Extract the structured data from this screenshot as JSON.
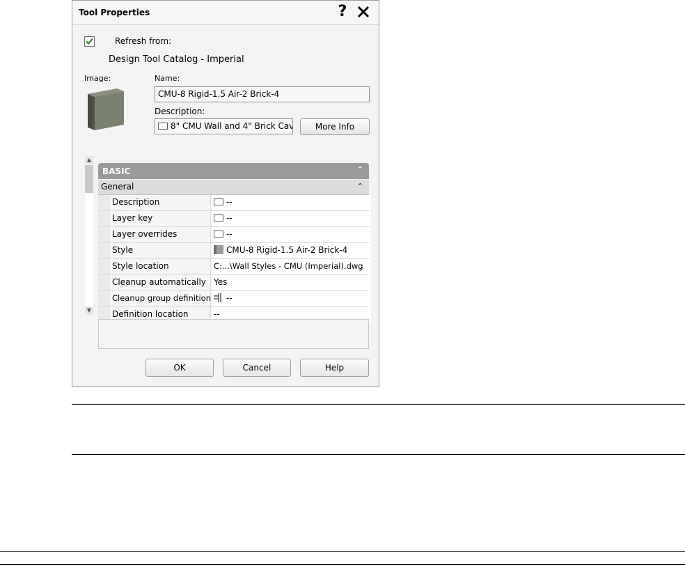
{
  "dialog": {
    "title": "Tool Properties",
    "refresh_label": "Refresh from:",
    "refresh_checked": true,
    "catalog_name": "Design Tool Catalog - Imperial",
    "image_label": "Image:",
    "name_label": "Name:",
    "name_value": "CMU-8 Rigid-1.5 Air-2 Brick-4",
    "description_label": "Description:",
    "description_value": "8\" CMU Wall and 4\" Brick Cav",
    "more_info_label": "More Info"
  },
  "properties": {
    "category": "BASIC",
    "group": "General",
    "rows": [
      {
        "key": "Description",
        "value": "--",
        "icon": "message-icon"
      },
      {
        "key": "Layer key",
        "value": "--",
        "icon": "message-icon"
      },
      {
        "key": "Layer overrides",
        "value": "--",
        "icon": "message-icon"
      },
      {
        "key": "Style",
        "value": "CMU-8 Rigid-1.5 Air-2 Brick-4",
        "icon": "wall-style-icon"
      },
      {
        "key": "Style location",
        "value": "C:...\\Wall Styles - CMU (Imperial).dwg",
        "icon": ""
      },
      {
        "key": "Cleanup automatically",
        "value": "Yes",
        "icon": ""
      },
      {
        "key": "Cleanup group definition",
        "value": "--",
        "icon": "cleanup-group-icon"
      },
      {
        "key": "Definition location",
        "value": "--",
        "icon": ""
      }
    ]
  },
  "buttons": {
    "ok": "OK",
    "cancel": "Cancel",
    "help": "Help"
  },
  "colors": {
    "checkmark": "#2e8b2e",
    "category_bar": "#9a9a9a"
  }
}
